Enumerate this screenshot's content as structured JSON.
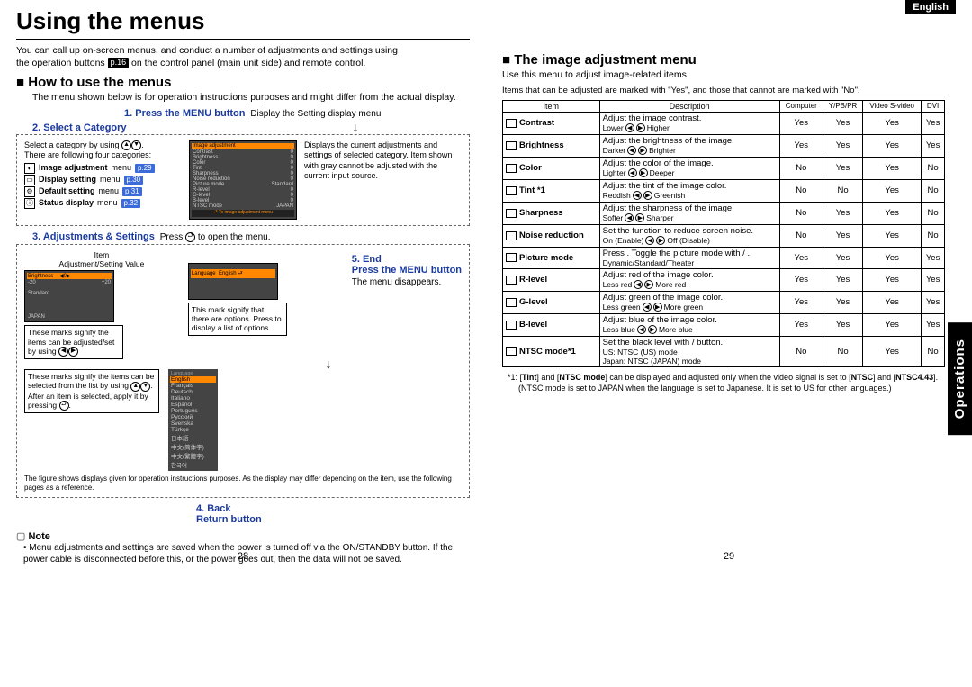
{
  "header": {
    "language_tab": "English",
    "title": "Using the menus"
  },
  "intro": {
    "line1": "You can call up on-screen menus, and conduct a number of adjustments and settings using",
    "line2_a": "the operation buttons ",
    "page_ref": "p.16",
    "line2_b": " on the control panel (main unit side) and remote control."
  },
  "left": {
    "h2": "How to use the menus",
    "sub": "The menu shown below is for operation instructions purposes and might differ from the actual display.",
    "step1_label": "1. Press the MENU button",
    "step1_text": "Display the Setting display menu",
    "step2_label": "2. Select a Category",
    "cat_intro_a": "Select a category by using ",
    "cat_intro_b": ".",
    "cat_intro2": "There are following four categories:",
    "categories": [
      {
        "name": "Image adjustment",
        "suffix": "menu",
        "ref": "p.29"
      },
      {
        "name": "Display setting",
        "suffix": "menu",
        "ref": "p.30"
      },
      {
        "name": "Default setting",
        "suffix": "menu",
        "ref": "p.31"
      },
      {
        "name": "Status display",
        "suffix": "menu",
        "ref": "p.32"
      }
    ],
    "cat_right": "Displays the current adjustments and settings of selected category. Item shown with gray cannot be adjusted with the current input source.",
    "mini_menu_title": "Image adjustment",
    "mini_rows": [
      {
        "l": "Contrast",
        "r": "0"
      },
      {
        "l": "Brightness",
        "r": "0"
      },
      {
        "l": "Color",
        "r": "0"
      },
      {
        "l": "Tint",
        "r": "0"
      },
      {
        "l": "Sharpness",
        "r": "0"
      },
      {
        "l": "Noise reduction",
        "r": "0"
      },
      {
        "l": "Picture mode",
        "r": "Standard"
      },
      {
        "l": "R-level",
        "r": "0"
      },
      {
        "l": "G-level",
        "r": "0"
      },
      {
        "l": "B-level",
        "r": "0"
      },
      {
        "l": "NTSC mode",
        "r": "JAPAN"
      }
    ],
    "mini_footer": "To image adjustment menu",
    "step3_label": "3. Adjustments & Settings",
    "step3_text": "Press      to open the menu.",
    "item_label": "Item",
    "adj_label": "Adjustment/Setting Value",
    "callout1": "These marks signify the items can be adjusted/set by using",
    "callout2": "This mark signify that there are options. Press      to display a list of options.",
    "callout3a": "These marks signify the items can be selected from the list by using",
    "callout3b": "After an item is selected, apply it by pressing",
    "lang_label": "Language",
    "lang_sel": "English",
    "lang_list": [
      "English",
      "Français",
      "Deutsch",
      "Italiano",
      "Español",
      "Português",
      "Русский",
      "Svenska",
      "Türkçe",
      "日本語",
      "中文(简体字)",
      "中文(繁體字)",
      "한국어"
    ],
    "footer_note": "The figure shows displays given for operation instructions purposes. As the display may differ depending on the item, use the following pages as a reference.",
    "step4_label": "4. Back",
    "step4_text": "Return button",
    "step5_label": "5. End",
    "step5_text": "Press the MENU button",
    "step5_sub": "The menu disappears.",
    "note_label": "Note",
    "note_body": "Menu adjustments and settings are saved when the power is turned off via the ON/STANDBY button. If the power cable is disconnected before this, or the power goes out, then the data will not be saved.",
    "page_num": "28"
  },
  "right": {
    "h2": "The image adjustment menu",
    "sub1": "Use this menu to adjust image-related items.",
    "sub2": "Items that can be adjusted are marked with \"Yes\", and those that cannot are marked with \"No\".",
    "side_tab": "Operations",
    "headers": [
      "Item",
      "Description",
      "Computer",
      "Y/PB/PR",
      "Video S-video",
      "DVI"
    ],
    "rows": [
      {
        "name": "Contrast",
        "desc": "Adjust the image contrast.",
        "sub_l": "Lower",
        "sub_r": "Higher",
        "c": [
          "Yes",
          "Yes",
          "Yes",
          "Yes"
        ]
      },
      {
        "name": "Brightness",
        "desc": "Adjust the brightness of the image.",
        "sub_l": "Darker",
        "sub_r": "Brighter",
        "c": [
          "Yes",
          "Yes",
          "Yes",
          "Yes"
        ]
      },
      {
        "name": "Color",
        "desc": "Adjust the color of the image.",
        "sub_l": "Lighter",
        "sub_r": "Deeper",
        "c": [
          "No",
          "Yes",
          "Yes",
          "No"
        ]
      },
      {
        "name": "Tint *1",
        "desc": "Adjust the tint of the image color.",
        "sub_l": "Reddish",
        "sub_r": "Greenish",
        "c": [
          "No",
          "No",
          "Yes",
          "No"
        ]
      },
      {
        "name": "Sharpness",
        "desc": "Adjust the sharpness of the image.",
        "sub_l": "Softer",
        "sub_r": "Sharper",
        "c": [
          "No",
          "Yes",
          "Yes",
          "No"
        ]
      },
      {
        "name": "Noise reduction",
        "desc": "Set the function to reduce screen noise.",
        "sub_l": "On (Enable)",
        "sub_r": "Off (Disable)",
        "c": [
          "No",
          "Yes",
          "Yes",
          "No"
        ]
      },
      {
        "name": "Picture mode",
        "desc": "Press     . Toggle the picture mode with      /     .",
        "sub_plain": "Dynamic/Standard/Theater",
        "c": [
          "Yes",
          "Yes",
          "Yes",
          "Yes"
        ]
      },
      {
        "name": "R-level",
        "desc": "Adjust red of the image color.",
        "sub_l": "Less red",
        "sub_r": "More red",
        "c": [
          "Yes",
          "Yes",
          "Yes",
          "Yes"
        ]
      },
      {
        "name": "G-level",
        "desc": "Adjust green of the image color.",
        "sub_l": "Less green",
        "sub_r": "More green",
        "c": [
          "Yes",
          "Yes",
          "Yes",
          "Yes"
        ]
      },
      {
        "name": "B-level",
        "desc": "Adjust blue of the image color.",
        "sub_l": "Less blue",
        "sub_r": "More blue",
        "c": [
          "Yes",
          "Yes",
          "Yes",
          "Yes"
        ]
      },
      {
        "name": "NTSC mode*1",
        "desc": "Set the black level with      /      button.",
        "sub_plain": "US:    NTSC (US) mode\nJapan: NTSC (JAPAN) mode",
        "c": [
          "No",
          "No",
          "Yes",
          "No"
        ]
      }
    ],
    "foot_prefix": "*1:",
    "foot": "Tint and NTSC mode can be displayed and adjusted only when the video signal is set to NTSC and NTSC4.43. (NTSC mode is set to JAPAN when the language is set to Japanese. It is set to US for other languages.)",
    "page_num": "29"
  }
}
